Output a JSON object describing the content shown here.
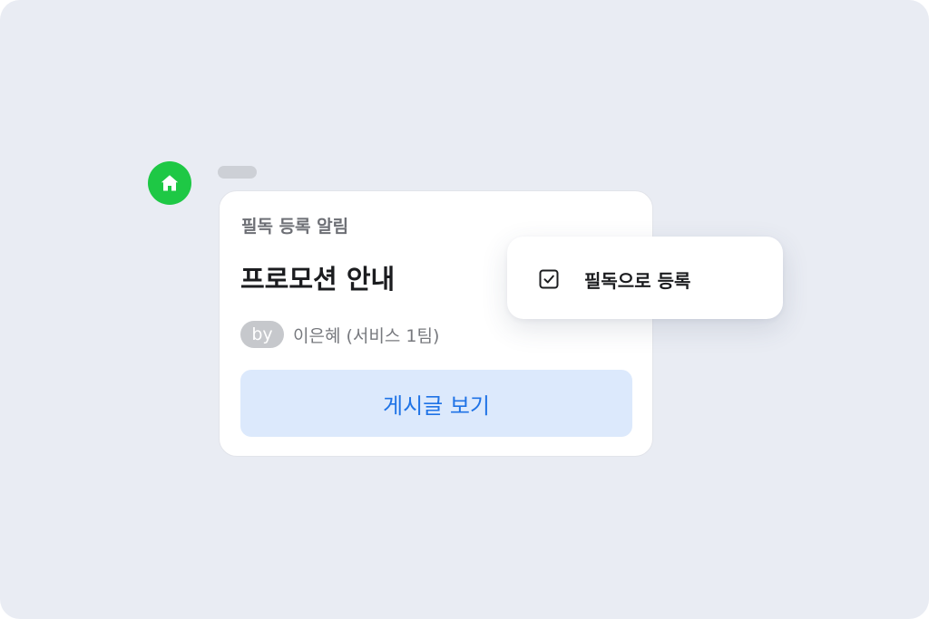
{
  "colors": {
    "background": "#e9ecf3",
    "app_icon": "#1ec845",
    "button_bg": "#dce9fc",
    "button_text": "#1f73e6"
  },
  "app": {
    "icon": "home-icon"
  },
  "message": {
    "label": "필독 등록 알림",
    "title": "프로모션 안내",
    "by_badge": "by",
    "author": "이은혜 (서비스 1팀)",
    "view_button": "게시글 보기"
  },
  "context_menu": {
    "items": [
      {
        "icon": "checkbox-icon",
        "label": "필독으로 등록"
      }
    ]
  }
}
